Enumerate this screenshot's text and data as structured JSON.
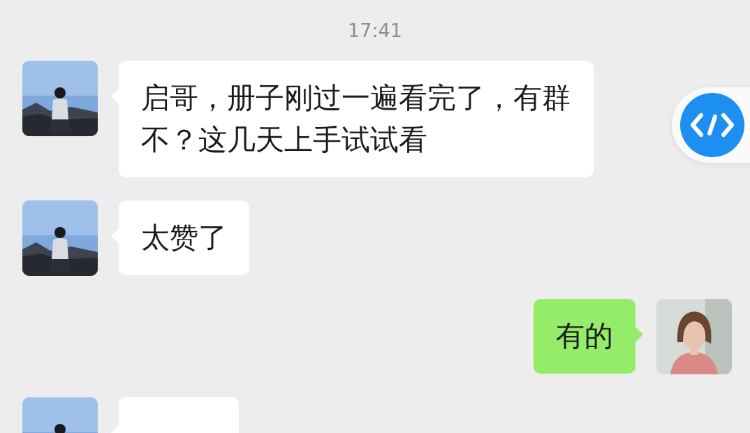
{
  "time": "17:41",
  "messages": [
    {
      "kind": "incoming",
      "text": "启哥，册子刚过一遍看完了，有群不？这几天上手试试看"
    },
    {
      "kind": "incoming",
      "text": "太赞了"
    },
    {
      "kind": "outgoing",
      "text": "有的"
    },
    {
      "kind": "incoming"
    }
  ],
  "floating_button": {
    "kind": "code"
  }
}
